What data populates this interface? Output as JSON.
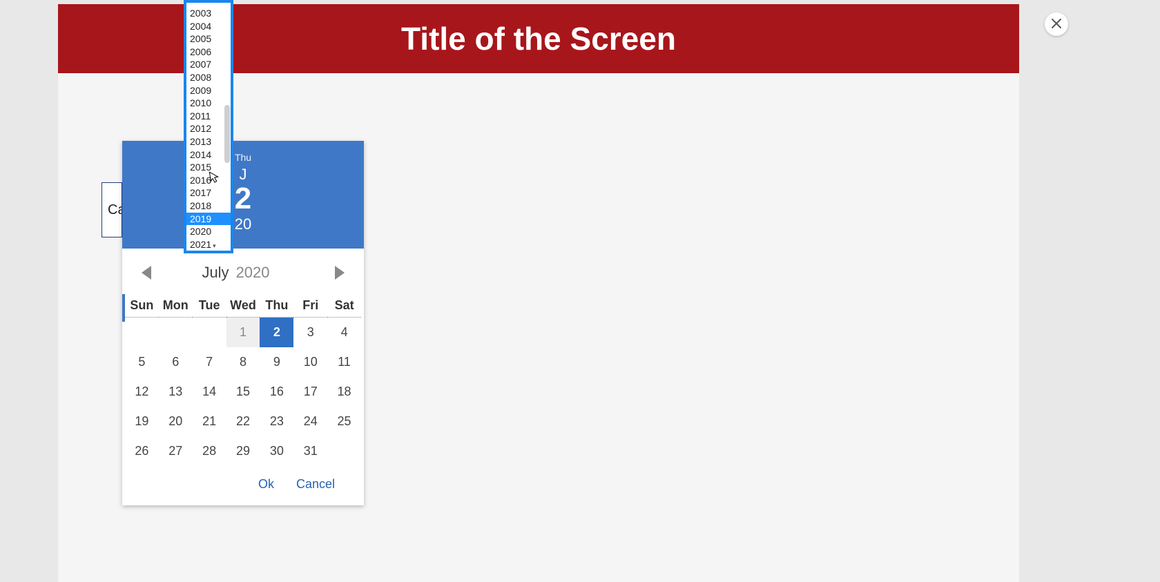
{
  "header": {
    "title": "Title of the Screen"
  },
  "field": {
    "partial_label": "Ca"
  },
  "datepicker": {
    "header": {
      "weekday": "Thu",
      "month_short": "J",
      "day": "2",
      "year_partial": "20"
    },
    "nav": {
      "month": "July",
      "year": "2020"
    },
    "weekdays": [
      "Sun",
      "Mon",
      "Tue",
      "Wed",
      "Thu",
      "Fri",
      "Sat"
    ],
    "rows": [
      [
        "",
        "",
        "",
        "1",
        "2",
        "3",
        "4"
      ],
      [
        "5",
        "6",
        "7",
        "8",
        "9",
        "10",
        "11"
      ],
      [
        "12",
        "13",
        "14",
        "15",
        "16",
        "17",
        "18"
      ],
      [
        "19",
        "20",
        "21",
        "22",
        "23",
        "24",
        "25"
      ],
      [
        "26",
        "27",
        "28",
        "29",
        "30",
        "31",
        ""
      ]
    ],
    "selected_day": "2",
    "other_month_days_row0": [
      "1"
    ],
    "actions": {
      "ok": "Ok",
      "cancel": "Cancel"
    }
  },
  "year_dropdown": {
    "years": [
      "2003",
      "2004",
      "2005",
      "2006",
      "2007",
      "2008",
      "2009",
      "2010",
      "2011",
      "2012",
      "2013",
      "2014",
      "2015",
      "2016",
      "2017",
      "2018",
      "2019",
      "2020",
      "2021"
    ],
    "highlighted": "2019",
    "has_more_below": true
  }
}
